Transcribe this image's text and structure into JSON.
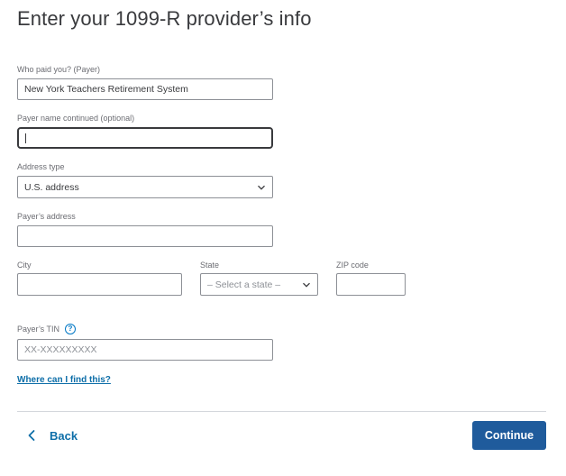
{
  "header": {
    "title": "Enter your 1099-R provider’s info"
  },
  "form": {
    "payer": {
      "label": "Who paid you? (Payer)",
      "value": "New York Teachers Retirement System"
    },
    "payer_continued": {
      "label": "Payer name continued (optional)",
      "value": ""
    },
    "address_type": {
      "label": "Address type",
      "selected": "U.S. address"
    },
    "payer_address": {
      "label": "Payer’s address",
      "value": ""
    },
    "city": {
      "label": "City",
      "value": ""
    },
    "state": {
      "label": "State",
      "selected": "– Select a state –"
    },
    "zip": {
      "label": "ZIP code",
      "value": ""
    },
    "tin": {
      "label": "Payer’s TIN",
      "placeholder": "XX-XXXXXXXXX",
      "help_icon": "question-circle-icon"
    },
    "help_link": "Where can I find this?"
  },
  "footer": {
    "back_label": "Back",
    "continue_label": "Continue"
  },
  "colors": {
    "primary_button": "#1f5b9c",
    "link": "#0d6ea8",
    "help_icon": "#0077c5",
    "border": "#8d9096"
  }
}
